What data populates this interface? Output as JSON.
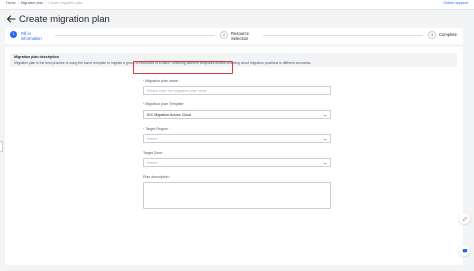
{
  "breadcrumb": {
    "items": [
      "Home",
      "Migration plan",
      "Create migration plan"
    ]
  },
  "header": {
    "online_support": "Online support",
    "title": "Create migration plan"
  },
  "steps": [
    {
      "number": "1",
      "label_line1": "Fill in",
      "label_line2": "information",
      "state": "active"
    },
    {
      "number": "2",
      "label_line1": "Resource",
      "label_line2": "Selection",
      "state": "pending"
    },
    {
      "number": "3",
      "label_line1": "Complete",
      "label_line2": "",
      "state": "pending"
    }
  ],
  "description": {
    "title": "Migration plan description",
    "text": "Migration plan is the best practice of using the same template to migrate a group of resources in a batch. Selecting different templates means selecting cloud migration positions in different scenarios."
  },
  "form": {
    "plan_name": {
      "label": "Migration plan name :",
      "placeholder": "Please enter the migration plan name",
      "required": "*"
    },
    "plan_template": {
      "label": "Migration plan Template :",
      "value": "IDC Migration Across Cloud",
      "required": "*"
    },
    "target_region": {
      "label": "Target Region :",
      "value": "Select",
      "required": "*"
    },
    "target_zone": {
      "label": "Target Zone :",
      "value": "Select"
    },
    "plan_description": {
      "label": "Plan description :",
      "value": ""
    }
  },
  "colors": {
    "primary": "#2468f2",
    "highlight": "#e03b2f",
    "link": "#1f66ff"
  },
  "icons": [
    "back-arrow-icon",
    "chevron-down-icon",
    "edit-pen-icon",
    "chat-icon"
  ]
}
